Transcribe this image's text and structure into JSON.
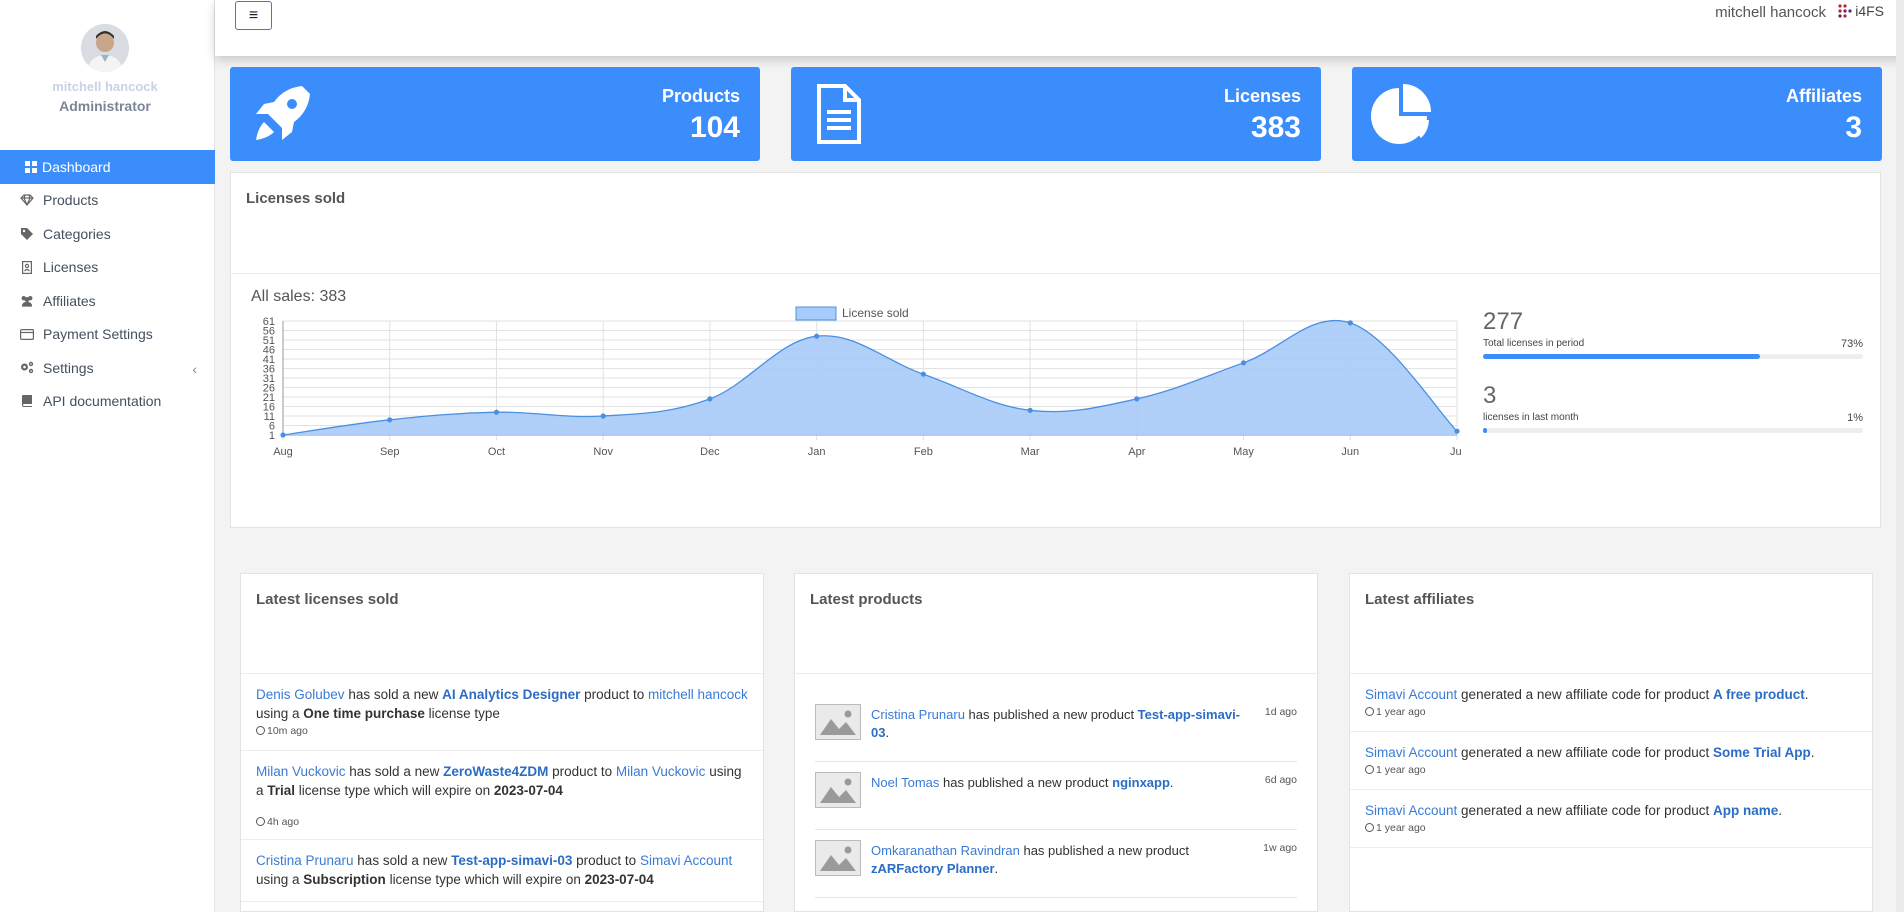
{
  "user": {
    "name": "mitchell hancock",
    "role": "Administrator"
  },
  "brand": {
    "logo_text": "i4FS",
    "accent": "#3c8dfc"
  },
  "sidebar": {
    "items": [
      {
        "label": "Dashboard",
        "icon": "dashboard-icon",
        "active": true
      },
      {
        "label": "Products",
        "icon": "diamond-icon"
      },
      {
        "label": "Categories",
        "icon": "tag-icon"
      },
      {
        "label": "Licenses",
        "icon": "license-icon"
      },
      {
        "label": "Affiliates",
        "icon": "users-icon"
      },
      {
        "label": "Payment Settings",
        "icon": "credit-card-icon"
      },
      {
        "label": "Settings",
        "icon": "cogs-icon",
        "has_submenu": true
      },
      {
        "label": "API documentation",
        "icon": "book-icon"
      }
    ]
  },
  "stats": {
    "products": {
      "label": "Products",
      "value": "104",
      "icon": "rocket-icon"
    },
    "licenses": {
      "label": "Licenses",
      "value": "383",
      "icon": "document-icon"
    },
    "affiliates": {
      "label": "Affiliates",
      "value": "3",
      "icon": "pie-chart-icon"
    }
  },
  "licenses_panel": {
    "title": "Licenses sold",
    "all_sales": "All sales: 383",
    "kpis": [
      {
        "value": "277",
        "label": "Total licenses in period",
        "percent_text": "73%",
        "progress": 0.73
      },
      {
        "value": "3",
        "label": "licenses in last month",
        "percent_text": "1%",
        "progress": 0.01
      }
    ]
  },
  "chart_data": {
    "type": "area",
    "series": [
      {
        "name": "License sold",
        "values": [
          1,
          9,
          13,
          11,
          20,
          53,
          33,
          14,
          20,
          39,
          60,
          3
        ]
      }
    ],
    "categories": [
      "Aug",
      "Sep",
      "Oct",
      "Nov",
      "Dec",
      "Jan",
      "Feb",
      "Mar",
      "Apr",
      "May",
      "Jun",
      "Jul"
    ],
    "y_ticks": [
      1,
      6,
      11,
      16,
      21,
      26,
      31,
      36,
      41,
      46,
      51,
      56,
      61
    ],
    "ylim": [
      1,
      61
    ],
    "grid": true,
    "legend": "top-center",
    "fill_color": "#a7cbfa",
    "line_color": "#4a90e2"
  },
  "latest_licenses": {
    "title": "Latest licenses sold",
    "items": [
      {
        "buyer": "Denis Golubev",
        "t1": " has sold a new ",
        "product": "AI Analytics Designer",
        "t2": " product to ",
        "seller": "mitchell hancock",
        "t3": " using a ",
        "type": "One time purchase",
        "t4": " license type",
        "time": "10m ago"
      },
      {
        "buyer": "Milan Vuckovic",
        "t1": " has sold a new ",
        "product": "ZeroWaste4ZDM",
        "t2": " product to ",
        "seller": "Milan Vuckovic",
        "t3": " using a ",
        "type": "Trial",
        "t4": " license type which will expire on ",
        "expiry": "2023-07-04",
        "time": "4h ago"
      },
      {
        "buyer": "Cristina Prunaru",
        "t1": " has sold a new ",
        "product": "Test-app-simavi-03",
        "t2": " product to ",
        "seller": "Simavi Account",
        "t3": " using a ",
        "type": "Subscription",
        "t4": " license type which will expire on ",
        "expiry": "2023-07-04",
        "time": ""
      }
    ]
  },
  "latest_products": {
    "title": "Latest products",
    "items": [
      {
        "author": "Cristina Prunaru",
        "text": " has published a new product ",
        "product": "Test-app-simavi-03",
        "end": ".",
        "ago": "1d ago"
      },
      {
        "author": "Noel Tomas",
        "text": " has published a new product ",
        "product": "nginxapp",
        "end": ".",
        "ago": "6d ago"
      },
      {
        "author": "Omkaranathan Ravindran",
        "text": " has published a new product ",
        "product": "zARFactory Planner",
        "end": ".",
        "ago": "1w ago"
      }
    ]
  },
  "latest_affiliates": {
    "title": "Latest affiliates",
    "items": [
      {
        "account": "Simavi Account",
        "text": " generated a new affiliate code for product ",
        "product": "A free product",
        "end": ".",
        "time": "1 year ago"
      },
      {
        "account": "Simavi Account",
        "text": " generated a new affiliate code for product ",
        "product": "Some Trial App",
        "end": ".",
        "time": "1 year ago"
      },
      {
        "account": "Simavi Account",
        "text": " generated a new affiliate code for product ",
        "product": "App name",
        "end": ".",
        "time": "1 year ago"
      }
    ]
  }
}
